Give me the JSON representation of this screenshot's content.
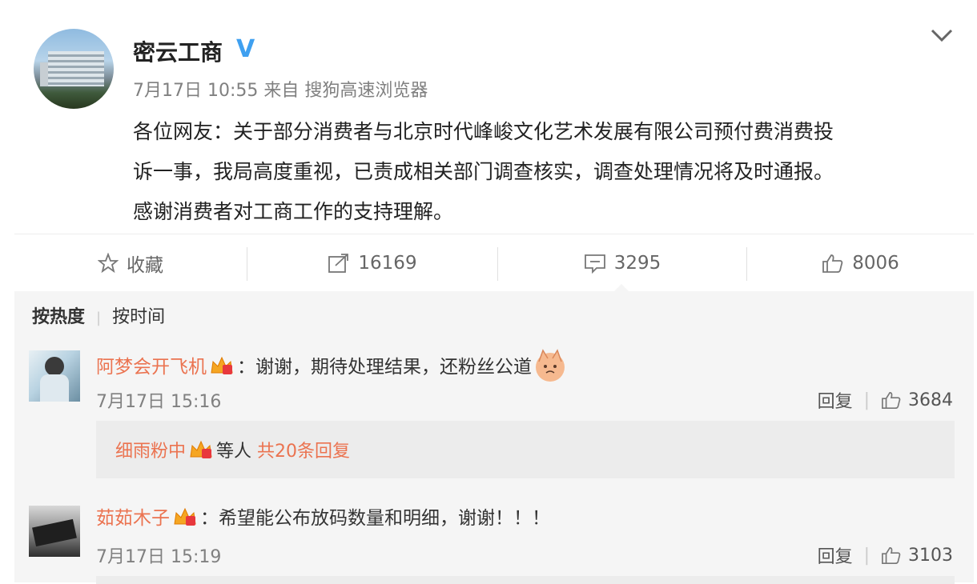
{
  "post": {
    "username": "密云工商",
    "verified_badge": "V",
    "meta": "7月17日 10:55 来自 搜狗高速浏览器",
    "content_lines": [
      "各位网友：关于部分消费者与北京时代峰峻文化艺术发展有限公司预付费消费投",
      "诉一事，我局高度重视，已责成相关部门调查核实，调查处理情况将及时通报。",
      "感谢消费者对工商工作的支持理解。"
    ]
  },
  "actions": {
    "favorite": "收藏",
    "repost": "16169",
    "comment": "3295",
    "like": "8006"
  },
  "sort": {
    "hot": "按热度",
    "time": "按时间"
  },
  "comments": [
    {
      "name": "阿梦会开飞机",
      "text": "：谢谢，期待处理结果，还粉丝公道",
      "time": "7月17日 15:16",
      "reply_label": "回复",
      "likes": "3684",
      "replies": {
        "name": "细雨粉中",
        "middle": "等人",
        "count_text": "共20条回复"
      }
    },
    {
      "name": "茹茹木子",
      "text": "：希望能公布放码数量和明细，谢谢！！！",
      "time": "7月17日 15:19",
      "reply_label": "回复",
      "likes": "3103"
    }
  ],
  "colors": {
    "name_orange": "#eb7350",
    "verified_blue": "#3fa0f0",
    "comment_bg": "#f5f5f5"
  }
}
